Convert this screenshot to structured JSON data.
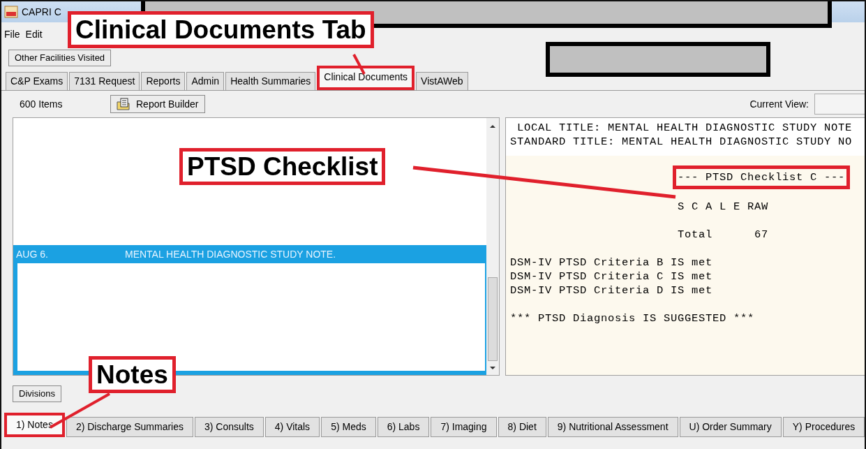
{
  "window": {
    "title": "CAPRI C"
  },
  "menu": [
    {
      "label": "File"
    },
    {
      "label": "Edit"
    }
  ],
  "facilities_button": "Other Facilities Visited",
  "tabs": [
    {
      "label": "C&P Exams",
      "selected": false,
      "annotated": false
    },
    {
      "label": "7131 Request",
      "selected": false,
      "annotated": false
    },
    {
      "label": "Reports",
      "selected": false,
      "annotated": false
    },
    {
      "label": "Admin",
      "selected": false,
      "annotated": false
    },
    {
      "label": "Health Summaries",
      "selected": false,
      "annotated": false
    },
    {
      "label": "Clinical Documents",
      "selected": true,
      "annotated": true
    },
    {
      "label": "VistAWeb",
      "selected": false,
      "annotated": false
    }
  ],
  "toolbar": {
    "item_count": "600 Items",
    "report_button": "Report Builder",
    "view_label": "Current View:"
  },
  "note_list": {
    "rows": [
      {
        "date": "AUG 6.",
        "title": "MENTAL HEALTH DIAGNOSTIC STUDY NOTE.",
        "selected": true
      }
    ]
  },
  "document": {
    "header_lines": [
      " LOCAL TITLE: MENTAL HEALTH DIAGNOSTIC STUDY NOTE",
      "STANDARD TITLE: MENTAL HEALTH DIAGNOSTIC STUDY NO"
    ],
    "blocks": [
      [
        {
          "text": "--- PTSD Checklist C ---",
          "kind": "indented",
          "annotated": true
        }
      ],
      [
        {
          "text": "S C A L E RAW",
          "kind": "indented",
          "annotated": false
        }
      ],
      [
        {
          "text": "Total      67",
          "kind": "indented",
          "annotated": false
        }
      ],
      [
        {
          "text": "DSM-IV PTSD Criteria B IS met",
          "kind": "plain",
          "annotated": false
        },
        {
          "text": "DSM-IV PTSD Criteria C IS met",
          "kind": "plain",
          "annotated": false
        },
        {
          "text": "DSM-IV PTSD Criteria D IS met",
          "kind": "plain",
          "annotated": false
        }
      ],
      [
        {
          "text": "*** PTSD Diagnosis IS SUGGESTED ***",
          "kind": "plain",
          "annotated": false
        }
      ]
    ]
  },
  "divisions_button": "Divisions",
  "bottom_tabs": [
    {
      "label": "1) Notes",
      "selected": true,
      "annotated": true
    },
    {
      "label": "2) Discharge Summaries",
      "selected": false,
      "annotated": false
    },
    {
      "label": "3) Consults",
      "selected": false,
      "annotated": false
    },
    {
      "label": "4) Vitals",
      "selected": false,
      "annotated": false
    },
    {
      "label": "5) Meds",
      "selected": false,
      "annotated": false
    },
    {
      "label": "6) Labs",
      "selected": false,
      "annotated": false
    },
    {
      "label": "7) Imaging",
      "selected": false,
      "annotated": false
    },
    {
      "label": "8) Diet",
      "selected": false,
      "annotated": false
    },
    {
      "label": "9) Nutritional Assessment",
      "selected": false,
      "annotated": false
    },
    {
      "label": "U) Order Summary",
      "selected": false,
      "annotated": false
    },
    {
      "label": "Y) Procedures",
      "selected": false,
      "annotated": false
    }
  ],
  "callouts": [
    {
      "text": "Clinical Documents Tab"
    },
    {
      "text": "PTSD Checklist"
    },
    {
      "text": "Notes"
    }
  ]
}
